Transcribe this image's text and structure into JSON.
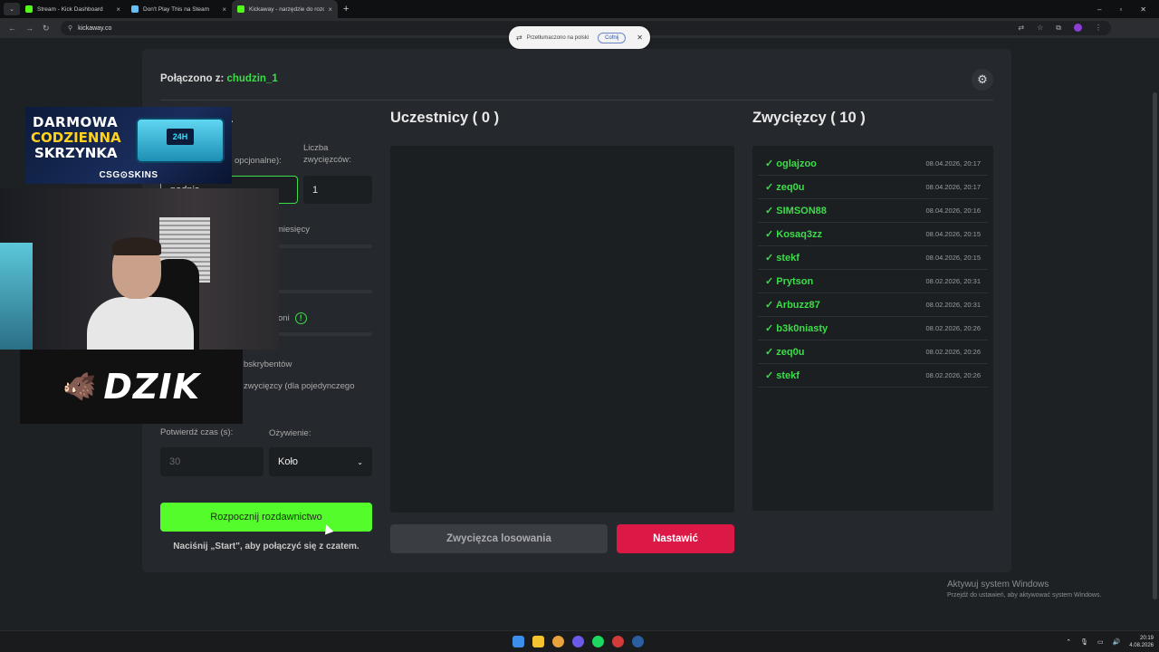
{
  "browser": {
    "tabs": [
      {
        "title": "Stream - Kick Dashboard",
        "fav_color": "#53fc18",
        "active": false
      },
      {
        "title": "Don't Play This na Steam",
        "fav_color": "#1b2838",
        "active": false
      },
      {
        "title": "Kickaway - narzędzie do rozda...",
        "fav_color": "#53fc18",
        "active": true
      }
    ],
    "url": "kickaway.co",
    "translate_popup": {
      "text": "Przetłumaczono na polski",
      "undo": "Cofnij"
    }
  },
  "page": {
    "connected_label": "Połączono z:",
    "connected_user": "chudzin_1",
    "left": {
      "heading_partial": "ia",
      "label_keyword_partial": "opcjonalne):",
      "keyword_value_partial": "podpis",
      "label_winners": "Liczba zwycięzców:",
      "winners_value": "1",
      "label_months_partial": "miesięcy",
      "label_followers_partial": "oni",
      "label_subs_partial": "bskrybentów",
      "label_winner_msg_partial": "zwycięzcy (dla pojedynczego",
      "label_confirm_time": "Potwierdź czas (s):",
      "confirm_time_placeholder": "30",
      "label_animation": "Ożywienie:",
      "animation_value": "Koło",
      "start_button": "Rozpocznij rozdawnictwo",
      "hint": "Naciśnij „Start\", aby połączyć się z czatem."
    },
    "participants": {
      "heading": "Uczestnicy ( 0 )",
      "draw_button": "Zwycięzca losowania",
      "reset_button": "Nastawić"
    },
    "winners": {
      "heading": "Zwycięzcy ( 10 )",
      "rows": [
        {
          "name": "✓ oglajzoo",
          "date": "08.04.2026, 20:17"
        },
        {
          "name": "✓ zeq0u",
          "date": "08.04.2026, 20:17"
        },
        {
          "name": "✓ SIMSON88",
          "date": "08.04.2026, 20:16"
        },
        {
          "name": "✓ Kosaq3zz",
          "date": "08.04.2026, 20:15"
        },
        {
          "name": "✓ stekf",
          "date": "08.04.2026, 20:15"
        },
        {
          "name": "✓ Prytson",
          "date": "08.02.2026, 20:31"
        },
        {
          "name": "✓ Arbuzz87",
          "date": "08.02.2026, 20:31"
        },
        {
          "name": "✓ b3k0niasty",
          "date": "08.02.2026, 20:26"
        },
        {
          "name": "✓ zeq0u",
          "date": "08.02.2026, 20:26"
        },
        {
          "name": "✓ stekf",
          "date": "08.02.2026, 20:26"
        }
      ]
    }
  },
  "overlay": {
    "ad_line1": "DARMOWA",
    "ad_line2": "CODZIENNA",
    "ad_line3": "SKRZYNKA",
    "ad_timer": "24H",
    "ad_brand": "CSG⊙SKINS",
    "logo_text": "DZIK"
  },
  "windows": {
    "watermark_title": "Aktywuj system Windows",
    "watermark_sub": "Przejdź do ustawień, aby aktywować system Windows.",
    "time": "20:19",
    "date": "4.08.2026"
  },
  "colors": {
    "accent_green": "#54fc2c",
    "danger_red": "#dc1846"
  }
}
